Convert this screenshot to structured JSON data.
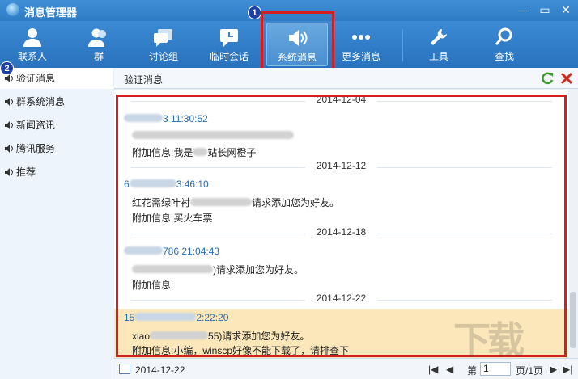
{
  "window": {
    "title": "消息管理器",
    "minimize": "—",
    "restore": "▭",
    "close": "✕"
  },
  "toolbar": {
    "contacts": "联系人",
    "groups": "群",
    "discussion": "讨论组",
    "temp_chat": "临时会话",
    "system_msg": "系统消息",
    "more_msg": "更多消息",
    "tools": "工具",
    "search": "查找"
  },
  "badges": {
    "one": "1",
    "two": "2"
  },
  "sidebar": {
    "items": [
      "验证消息",
      "群系统消息",
      "新闻资讯",
      "腾讯服务",
      "推荐"
    ]
  },
  "content": {
    "title": "验证消息"
  },
  "messages": [
    {
      "date": "2014-12-04",
      "sender": "3 11:30:52",
      "line2": "附加信息:我是",
      "line2_b": "站长网橙子"
    },
    {
      "date": "2014-12-12",
      "sender": "3:46:10",
      "sender_prefix": "6",
      "line1": "红花需绿叶衬",
      "line1_b": "请求添加您为好友。",
      "line2": "附加信息:买火车票"
    },
    {
      "date": "2014-12-18",
      "sender": "786 21:04:43",
      "line1_b": ")请求添加您为好友。",
      "line2": "附加信息:"
    },
    {
      "date": "2014-12-22",
      "sender": "2:22:20",
      "sender_prefix": "15",
      "line1": "xiao",
      "line1_b": "55)请求添加您为好友。",
      "line2": "附加信息:小编，winscp好像不能下载了，请排查下"
    }
  ],
  "footer": {
    "date": "2014-12-22",
    "page_prefix": "第",
    "page_value": "1",
    "page_total": "页/1页"
  },
  "colors": {
    "titlebar": "#2f7cc4",
    "highlight": "#d31f1f",
    "badge": "#1c3fa8",
    "sender": "#2b6cb0",
    "selected_row": "#fbe7b9"
  }
}
